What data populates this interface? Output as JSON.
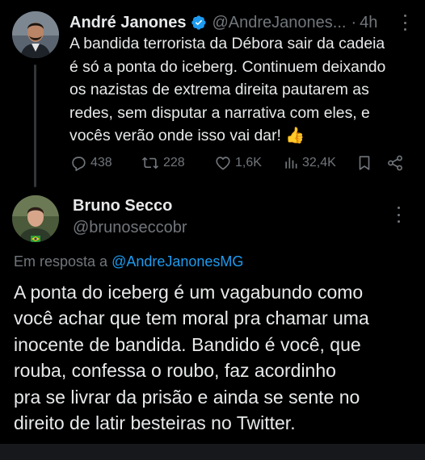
{
  "original_post": {
    "author_name": "André Janones",
    "author_handle": "@AndreJanones...",
    "separator": "·",
    "time": "4h",
    "text": "A bandida terrorista da Débora sair da cadeia\né só a ponta do iceberg. Continuem deixando\nos nazistas de extrema direita pautarem as\nredes, sem disputar a narrativa com eles, e\nvocês verão onde isso vai dar! 👍",
    "stats": {
      "replies": "438",
      "reposts": "228",
      "likes": "1,6K",
      "views": "32,4K"
    }
  },
  "reply_post": {
    "author_name": "Bruno Secco",
    "author_handle": "@brunoseccobr",
    "reply_to_prefix": "Em resposta a",
    "reply_to_mention": "@AndreJanonesMG",
    "text": "A ponta do iceberg é um vagabundo como\nvocê achar que tem moral pra chamar uma\ninocente de bandida. Bandido é você, que\nrouba, confessa o roubo, faz acordinho\npra se livrar da prisão e ainda se sente no\ndireito de latir besteiras no Twitter."
  },
  "colors": {
    "background": "#000000",
    "primary_text": "#e7e9ea",
    "secondary_text": "#71767b",
    "accent_blue": "#1d9bf0",
    "thread_line": "#333639"
  },
  "icons": {
    "verified": "verified-badge-icon",
    "reply": "reply-bubble-icon",
    "repost": "repost-arrows-icon",
    "like": "heart-icon",
    "views": "bar-chart-icon",
    "bookmark": "bookmark-icon",
    "share": "share-icon",
    "more": "more-vertical-icon"
  }
}
